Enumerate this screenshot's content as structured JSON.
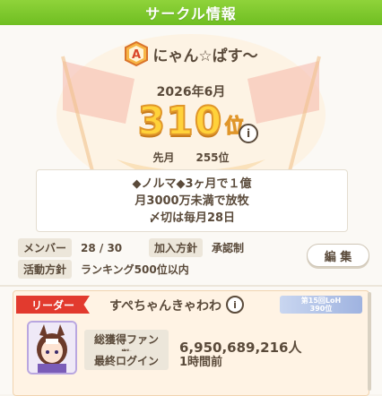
{
  "header": {
    "title": "サークル情報"
  },
  "circle": {
    "rank_emblem_letter": "A",
    "name": "にゃん☆ぱす～",
    "month": "2026年6月",
    "rank": "310",
    "rank_suffix": "位",
    "info_icon": "i",
    "last_month_label": "先月",
    "last_month_value": "255位",
    "description": [
      "◆ノルマ◆3ヶ月で１億",
      "月3000万未満で放牧",
      "〆切は毎月28日"
    ]
  },
  "details": {
    "members_label": "メンバー",
    "members_value": "28 / 30",
    "join_label": "加入方針",
    "join_value": "承認制",
    "activity_label": "活動方針",
    "activity_value": "ランキング500位以内",
    "edit_button": "編 集"
  },
  "leader": {
    "tag": "リーダー",
    "name": "すぺちゃんきゃわわ",
    "info_icon": "i",
    "badge_line1": "第15回LoH",
    "badge_line2": "390位",
    "fans_label": "総獲得ファン数",
    "fans_value": "6,950,689,216人",
    "login_label": "最終ログイン",
    "login_value": "1時間前"
  },
  "colors": {
    "header": "#7cc52c",
    "rank_gold": "#ffd23a",
    "leader_red": "#e23a2e"
  }
}
